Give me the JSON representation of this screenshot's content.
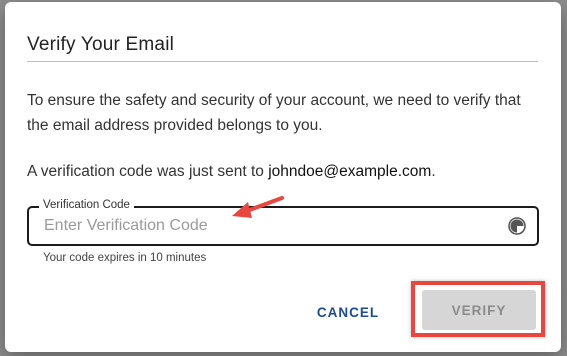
{
  "dialog": {
    "title": "Verify Your Email",
    "intro": "To ensure the safety and security of your account, we need to verify that the email address provided belongs to you.",
    "sent_prefix": "A verification code was just sent to ",
    "email": "johndoe@example.com",
    "sent_suffix": "."
  },
  "field": {
    "label": "Verification Code",
    "value": "",
    "placeholder": "Enter Verification Code",
    "icon": "timer-icon",
    "helper": "Your code expires in 10 minutes"
  },
  "actions": {
    "cancel_label": "CANCEL",
    "verify_label": "VERIFY",
    "verify_disabled": true
  },
  "annotation": {
    "arrow_color": "#e8473f",
    "highlight_color": "#e8473f"
  },
  "colors": {
    "cancel_text": "#1a4c8f",
    "verify_bg_disabled": "#d6d6d6"
  }
}
